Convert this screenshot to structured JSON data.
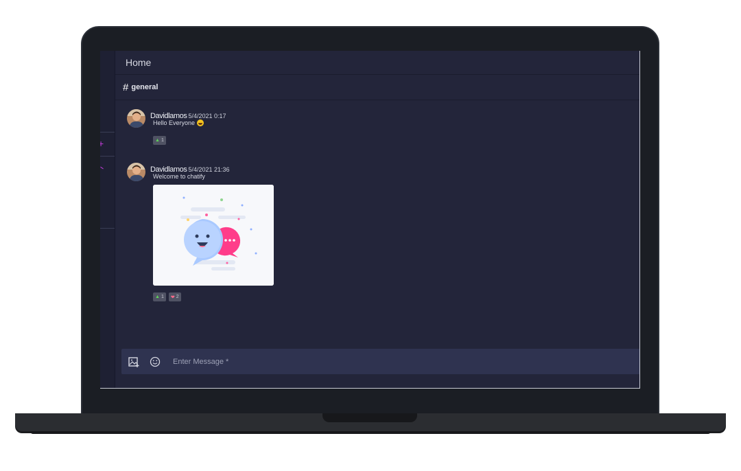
{
  "header": {
    "title": "Home"
  },
  "channel": {
    "hash": "#",
    "name": "general"
  },
  "messages": [
    {
      "author": "Davidlamos",
      "timestamp": "5/4/2021 0:17",
      "text": "Hello Everyone",
      "emoji": "grinning-face-icon",
      "reactions": [
        {
          "icon": "thumbs-up-icon",
          "count": "1"
        }
      ]
    },
    {
      "author": "Davidlamos",
      "timestamp": "5/4/2021 21:36",
      "text": "Welcome to chatify",
      "attachment": "chat-bubbles-illustration",
      "reactions": [
        {
          "icon": "thumbs-up-icon",
          "count": "1"
        },
        {
          "icon": "heart-icon",
          "count": "2"
        }
      ]
    }
  ],
  "composer": {
    "placeholder": "Enter Message *"
  },
  "sidebar": {
    "add_icon": "+"
  },
  "colors": {
    "app_bg": "#23253a",
    "composer_bg": "#2f3350",
    "accent": "#c13bd9",
    "like": "#5fd35b",
    "heart": "#ff6b8c"
  }
}
